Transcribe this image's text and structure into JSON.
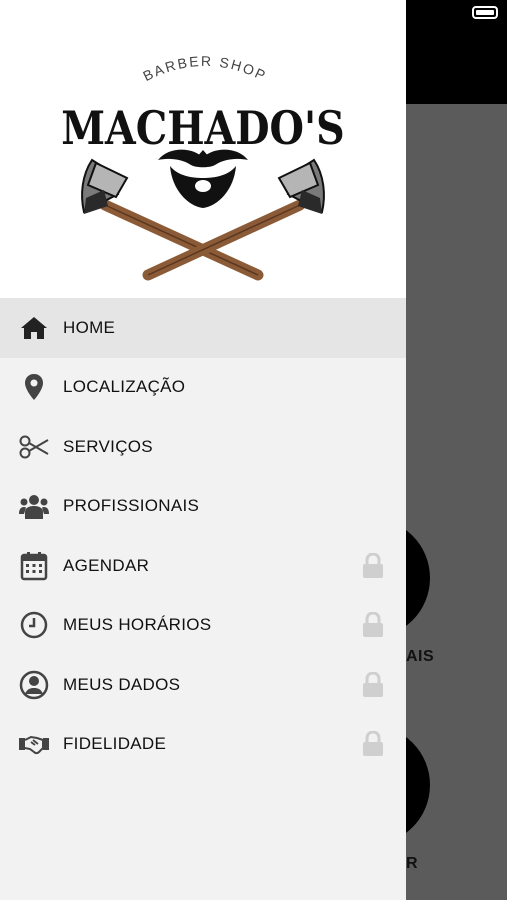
{
  "brand": {
    "subtitle": "BARBER SHOP",
    "name": "MACHADO'S"
  },
  "menu": {
    "items": [
      {
        "label": "HOME",
        "icon": "home-icon",
        "active": true,
        "locked": false
      },
      {
        "label": "LOCALIZAÇÃO",
        "icon": "location-pin-icon",
        "active": false,
        "locked": false
      },
      {
        "label": "SERVIÇOS",
        "icon": "scissors-icon",
        "active": false,
        "locked": false
      },
      {
        "label": "PROFISSIONAIS",
        "icon": "users-icon",
        "active": false,
        "locked": false
      },
      {
        "label": "AGENDAR",
        "icon": "calendar-icon",
        "active": false,
        "locked": true
      },
      {
        "label": "MEUS HORÁRIOS",
        "icon": "clock-icon",
        "active": false,
        "locked": true
      },
      {
        "label": "MEUS DADOS",
        "icon": "user-circle-icon",
        "active": false,
        "locked": true
      },
      {
        "label": "FIDELIDADE",
        "icon": "handshake-icon",
        "active": false,
        "locked": true
      }
    ]
  },
  "background": {
    "label_1": "AIS",
    "label_2": "R"
  },
  "colors": {
    "accent_dark": "#222222",
    "lock_gray": "#cfcfcf",
    "axe_handle": "#8b5a36"
  }
}
